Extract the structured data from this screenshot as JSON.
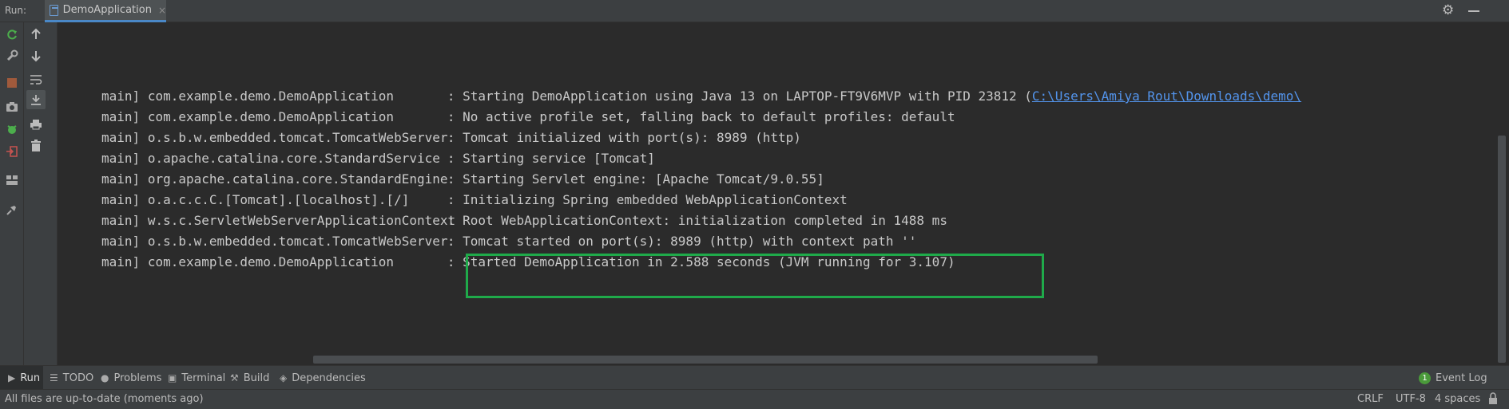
{
  "topbar": {
    "run_label": "Run:",
    "tab_label": "DemoApplication",
    "tab_close": "×"
  },
  "console": {
    "lines": [
      {
        "thread": "main]",
        "logger": "com.example.demo.DemoApplication",
        "message": "Starting DemoApplication using Java 13 on LAPTOP-FT9V6MVP with PID 23812 (",
        "link": "C:\\Users\\Amiya Rout\\Downloads\\demo\\"
      },
      {
        "thread": "main]",
        "logger": "com.example.demo.DemoApplication",
        "message": "No active profile set, falling back to default profiles: default"
      },
      {
        "thread": "main]",
        "logger": "o.s.b.w.embedded.tomcat.TomcatWebServer",
        "message": "Tomcat initialized with port(s): 8989 (http)"
      },
      {
        "thread": "main]",
        "logger": "o.apache.catalina.core.StandardService",
        "message": "Starting service [Tomcat]"
      },
      {
        "thread": "main]",
        "logger": "org.apache.catalina.core.StandardEngine",
        "message": "Starting Servlet engine: [Apache Tomcat/9.0.55]"
      },
      {
        "thread": "main]",
        "logger": "o.a.c.c.C.[Tomcat].[localhost].[/]",
        "message": "Initializing Spring embedded WebApplicationContext"
      },
      {
        "thread": "main]",
        "logger": "w.s.c.ServletWebServerApplicationContext",
        "message": "Root WebApplicationContext: initialization completed in 1488 ms"
      },
      {
        "thread": "main]",
        "logger": "o.s.b.w.embedded.tomcat.TomcatWebServer",
        "message": "Tomcat started on port(s): 8989 (http) with context path ''"
      },
      {
        "thread": "main]",
        "logger": "com.example.demo.DemoApplication",
        "message": "Started DemoApplication in 2.588 seconds (JVM running for 3.107)"
      }
    ],
    "highlight_color": "#1faa4a",
    "link_color": "#5394ec"
  },
  "left_toolbar": {
    "icons": [
      "rerun-icon",
      "wrench-icon",
      "stop-icon",
      "camera-icon",
      "debug-icon",
      "exit-icon",
      "layout-icon",
      "pin-icon"
    ]
  },
  "console_toolbar": {
    "icons": [
      "arrow-up-icon",
      "arrow-down-icon",
      "soft-wrap-icon",
      "scroll-to-end-icon",
      "print-icon",
      "trash-icon"
    ]
  },
  "bottom_tabs": [
    {
      "label": "Run",
      "icon": "run-icon"
    },
    {
      "label": "TODO",
      "icon": "list-icon"
    },
    {
      "label": "Problems",
      "icon": "info-icon"
    },
    {
      "label": "Terminal",
      "icon": "terminal-icon"
    },
    {
      "label": "Build",
      "icon": "hammer-icon"
    },
    {
      "label": "Dependencies",
      "icon": "stack-icon"
    }
  ],
  "event_log": {
    "badge": "1",
    "label": "Event Log"
  },
  "status_bar": {
    "message": "All files are up-to-date (moments ago)",
    "line_separator": "CRLF",
    "encoding": "UTF-8",
    "indent": "4 spaces"
  },
  "colors": {
    "background": "#2b2b2b",
    "panel": "#3c3f41",
    "text": "#c9c9c9",
    "accent": "#4a88c7"
  }
}
